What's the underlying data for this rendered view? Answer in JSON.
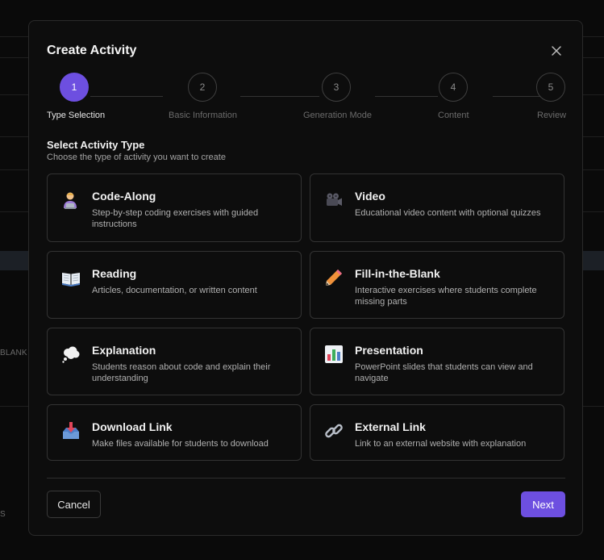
{
  "background": {
    "fragment_1": "BLANK",
    "fragment_2": "S"
  },
  "modal": {
    "title": "Create Activity",
    "close_icon": "close-icon"
  },
  "stepper": {
    "steps": [
      {
        "number": "1",
        "label": "Type Selection",
        "active": true
      },
      {
        "number": "2",
        "label": "Basic Information",
        "active": false
      },
      {
        "number": "3",
        "label": "Generation Mode",
        "active": false
      },
      {
        "number": "4",
        "label": "Content",
        "active": false
      },
      {
        "number": "5",
        "label": "Review",
        "active": false
      }
    ]
  },
  "section": {
    "title": "Select Activity Type",
    "subtitle": "Choose the type of activity you want to create"
  },
  "activity_types": [
    {
      "name": "Code-Along",
      "description": "Step-by-step coding exercises with guided instructions",
      "icon": "technologist-icon"
    },
    {
      "name": "Video",
      "description": "Educational video content with optional quizzes",
      "icon": "video-camera-icon"
    },
    {
      "name": "Reading",
      "description": "Articles, documentation, or written content",
      "icon": "open-book-icon"
    },
    {
      "name": "Fill-in-the-Blank",
      "description": "Interactive exercises where students complete missing parts",
      "icon": "pencil-icon"
    },
    {
      "name": "Explanation",
      "description": "Students reason about code and explain their understanding",
      "icon": "thought-bubble-icon"
    },
    {
      "name": "Presentation",
      "description": "PowerPoint slides that students can view and navigate",
      "icon": "bar-chart-icon"
    },
    {
      "name": "Download Link",
      "description": "Make files available for students to download",
      "icon": "inbox-download-icon"
    },
    {
      "name": "External Link",
      "description": "Link to an external website with explanation",
      "icon": "link-icon"
    }
  ],
  "footer": {
    "cancel_label": "Cancel",
    "next_label": "Next"
  },
  "colors": {
    "accent": "#6d4fe0",
    "background": "#0d0d0d",
    "border": "#333333"
  }
}
